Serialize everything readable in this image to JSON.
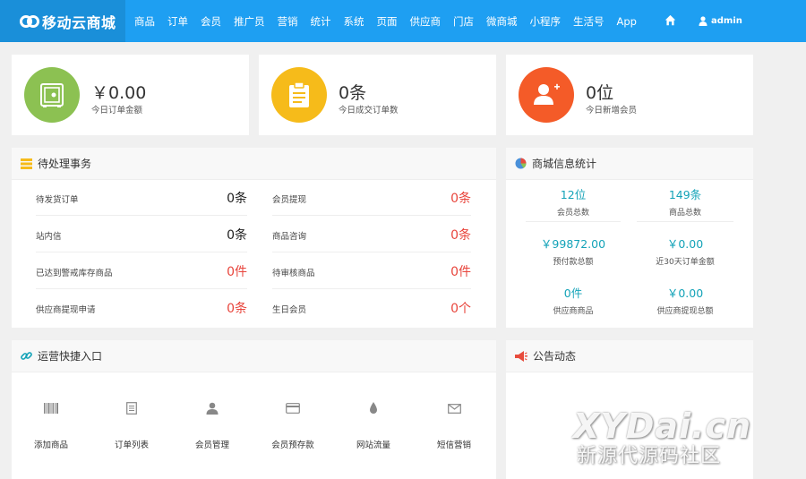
{
  "header": {
    "logo_text": "移动云商城",
    "nav": [
      "商品",
      "订单",
      "会员",
      "推广员",
      "营销",
      "统计",
      "系统",
      "页面",
      "供应商",
      "门店",
      "微商城",
      "小程序",
      "生活号",
      "App"
    ],
    "user": "admin"
  },
  "stats": [
    {
      "value": "￥0.00",
      "label": "今日订单金额",
      "color": "#8cc152"
    },
    {
      "value": "0条",
      "label": "今日成交订单数",
      "color": "#f6bb1a"
    },
    {
      "value": "0位",
      "label": "今日新增会员",
      "color": "#f45b28"
    }
  ],
  "todo": {
    "title": "待处理事务",
    "items": [
      {
        "label": "待发货订单",
        "value": "0条",
        "red": false
      },
      {
        "label": "会员提现",
        "value": "0条",
        "red": true
      },
      {
        "label": "站内信",
        "value": "0条",
        "red": false
      },
      {
        "label": "商品咨询",
        "value": "0条",
        "red": true
      },
      {
        "label": "已达到警戒库存商品",
        "value": "0件",
        "red": true
      },
      {
        "label": "待审核商品",
        "value": "0件",
        "red": true
      },
      {
        "label": "供应商提现申请",
        "value": "0条",
        "red": true
      },
      {
        "label": "生日会员",
        "value": "0个",
        "red": true
      }
    ]
  },
  "info": {
    "title": "商城信息统计",
    "items": [
      {
        "value": "12位",
        "label": "会员总数"
      },
      {
        "value": "149条",
        "label": "商品总数"
      },
      {
        "value": "￥99872.00",
        "label": "预付款总额"
      },
      {
        "value": "￥0.00",
        "label": "近30天订单金额"
      },
      {
        "value": "0件",
        "label": "供应商商品"
      },
      {
        "value": "￥0.00",
        "label": "供应商提现总额"
      }
    ]
  },
  "quick": {
    "title": "运营快捷入口",
    "items": [
      {
        "label": "添加商品",
        "icon": "barcode-icon"
      },
      {
        "label": "订单列表",
        "icon": "document-icon"
      },
      {
        "label": "会员管理",
        "icon": "user-icon"
      },
      {
        "label": "会员预存款",
        "icon": "credit-card-icon"
      },
      {
        "label": "网站流量",
        "icon": "droplet-icon"
      },
      {
        "label": "短信营销",
        "icon": "envelope-icon"
      }
    ]
  },
  "notice": {
    "title": "公告动态"
  },
  "watermark": {
    "line1": "XYDai.cn",
    "line2": "新源代源码社区"
  }
}
